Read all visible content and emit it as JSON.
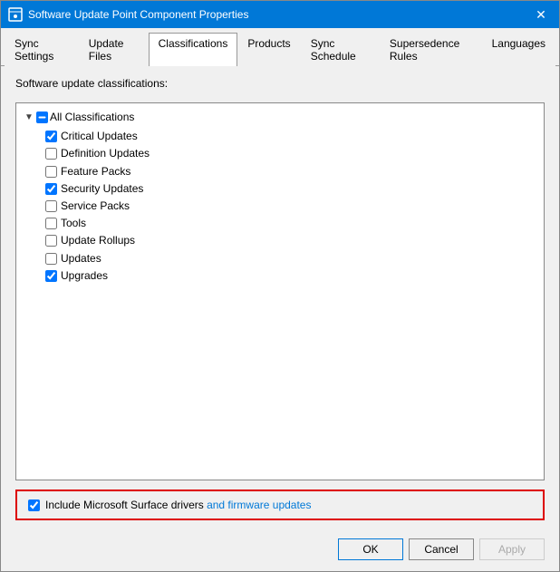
{
  "window": {
    "title": "Software Update Point Component Properties",
    "icon": "settings-icon"
  },
  "tabs": [
    {
      "label": "Sync Settings",
      "active": false
    },
    {
      "label": "Update Files",
      "active": false
    },
    {
      "label": "Classifications",
      "active": true
    },
    {
      "label": "Products",
      "active": false
    },
    {
      "label": "Sync Schedule",
      "active": false
    },
    {
      "label": "Supersedence Rules",
      "active": false
    },
    {
      "label": "Languages",
      "active": false
    }
  ],
  "section_label": "Software update classifications:",
  "tree": {
    "root_label": "All Classifications",
    "root_checked": false,
    "root_indeterminate": true,
    "items": [
      {
        "label": "Critical Updates",
        "checked": true
      },
      {
        "label": "Definition Updates",
        "checked": false
      },
      {
        "label": "Feature Packs",
        "checked": false
      },
      {
        "label": "Security Updates",
        "checked": true
      },
      {
        "label": "Service Packs",
        "checked": false
      },
      {
        "label": "Tools",
        "checked": false
      },
      {
        "label": "Update Rollups",
        "checked": false
      },
      {
        "label": "Updates",
        "checked": false
      },
      {
        "label": "Upgrades",
        "checked": true
      }
    ]
  },
  "include": {
    "checked": true,
    "label_plain": "Include Microsoft Surface drivers ",
    "label_blue": "and firmware updates"
  },
  "buttons": {
    "ok": "OK",
    "cancel": "Cancel",
    "apply": "Apply"
  }
}
